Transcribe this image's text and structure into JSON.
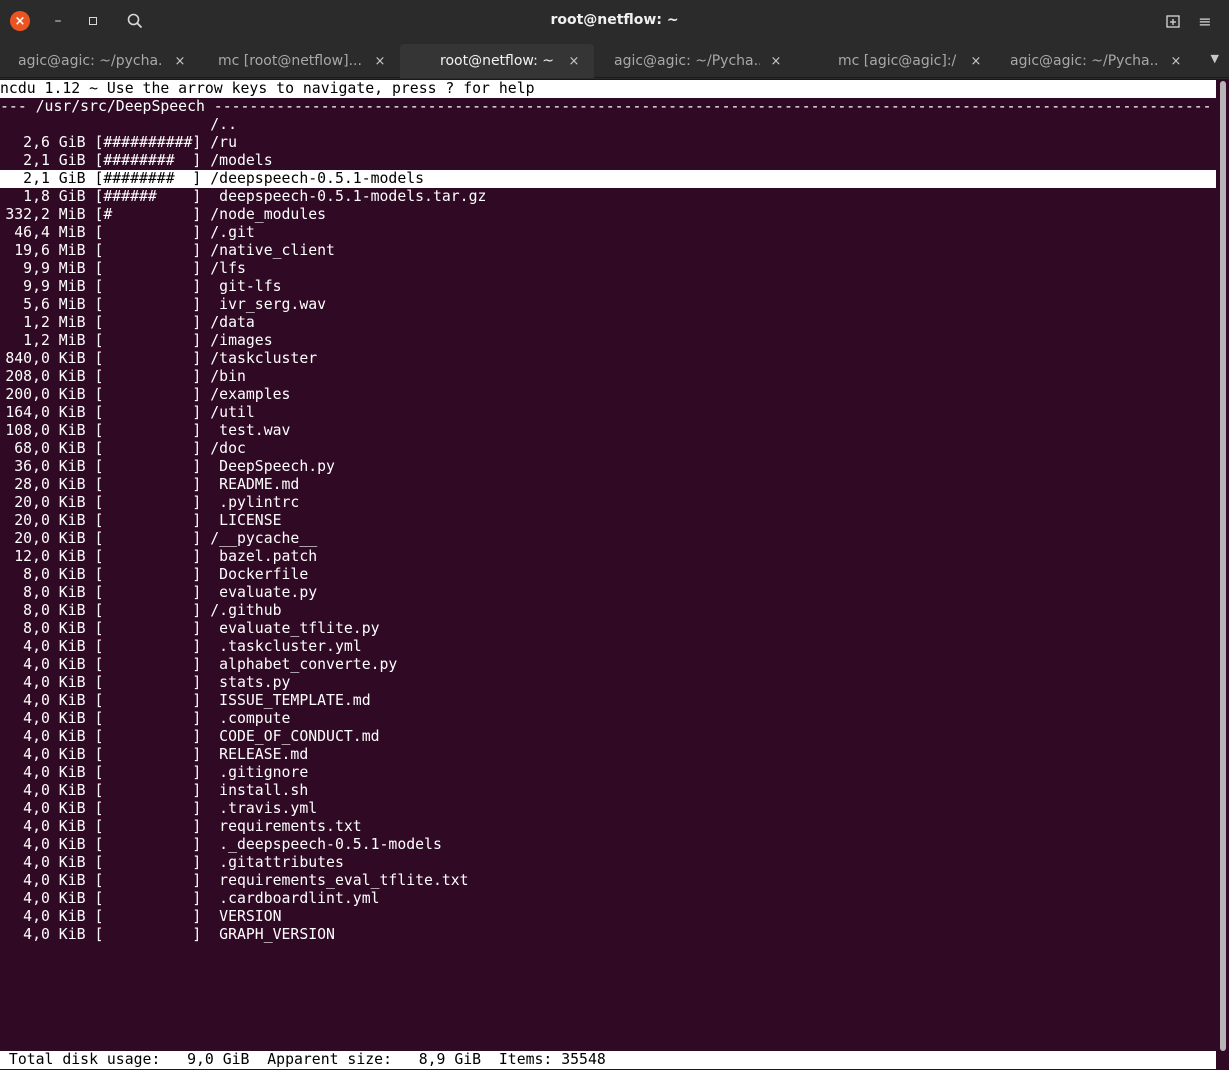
{
  "window": {
    "title": "root@netflow: ~",
    "close_glyph": "×",
    "minimize_glyph": "–",
    "menu_glyph": "≡"
  },
  "tabs": [
    {
      "label": "agic@agic: ~/pycha..."
    },
    {
      "label": "mc [root@netflow]..."
    },
    {
      "label": "root@netflow: ~",
      "active": true
    },
    {
      "label": "agic@agic: ~/Pycha..."
    },
    {
      "label": "mc [agic@agic]:/"
    },
    {
      "label": "agic@agic: ~/Pycha..."
    }
  ],
  "tab_close_glyph": "×",
  "tab_overflow_glyph": "▼",
  "terminal": {
    "header": "ncdu 1.12 ~ Use the arrow keys to navigate, press ? for help",
    "path_line": "--- /usr/src/DeepSpeech ----------------------------------------------------------------------------------------------------------------",
    "selected_index": 3,
    "rows": [
      {
        "size": "",
        "bar": "",
        "name": "/.."
      },
      {
        "size": "2,6 GiB",
        "bar": "[##########]",
        "name": "/ru"
      },
      {
        "size": "2,1 GiB",
        "bar": "[########  ]",
        "name": "/models"
      },
      {
        "size": "2,1 GiB",
        "bar": "[########  ]",
        "name": "/deepspeech-0.5.1-models"
      },
      {
        "size": "1,8 GiB",
        "bar": "[######    ]",
        "name": " deepspeech-0.5.1-models.tar.gz"
      },
      {
        "size": "332,2 MiB",
        "bar": "[#         ]",
        "name": "/node_modules"
      },
      {
        "size": "46,4 MiB",
        "bar": "[          ]",
        "name": "/.git"
      },
      {
        "size": "19,6 MiB",
        "bar": "[          ]",
        "name": "/native_client"
      },
      {
        "size": "9,9 MiB",
        "bar": "[          ]",
        "name": "/lfs"
      },
      {
        "size": "9,9 MiB",
        "bar": "[          ]",
        "name": " git-lfs"
      },
      {
        "size": "5,6 MiB",
        "bar": "[          ]",
        "name": " ivr_serg.wav"
      },
      {
        "size": "1,2 MiB",
        "bar": "[          ]",
        "name": "/data"
      },
      {
        "size": "1,2 MiB",
        "bar": "[          ]",
        "name": "/images"
      },
      {
        "size": "840,0 KiB",
        "bar": "[          ]",
        "name": "/taskcluster"
      },
      {
        "size": "208,0 KiB",
        "bar": "[          ]",
        "name": "/bin"
      },
      {
        "size": "200,0 KiB",
        "bar": "[          ]",
        "name": "/examples"
      },
      {
        "size": "164,0 KiB",
        "bar": "[          ]",
        "name": "/util"
      },
      {
        "size": "108,0 KiB",
        "bar": "[          ]",
        "name": " test.wav"
      },
      {
        "size": "68,0 KiB",
        "bar": "[          ]",
        "name": "/doc"
      },
      {
        "size": "36,0 KiB",
        "bar": "[          ]",
        "name": " DeepSpeech.py"
      },
      {
        "size": "28,0 KiB",
        "bar": "[          ]",
        "name": " README.md"
      },
      {
        "size": "20,0 KiB",
        "bar": "[          ]",
        "name": " .pylintrc"
      },
      {
        "size": "20,0 KiB",
        "bar": "[          ]",
        "name": " LICENSE"
      },
      {
        "size": "20,0 KiB",
        "bar": "[          ]",
        "name": "/__pycache__"
      },
      {
        "size": "12,0 KiB",
        "bar": "[          ]",
        "name": " bazel.patch"
      },
      {
        "size": "8,0 KiB",
        "bar": "[          ]",
        "name": " Dockerfile"
      },
      {
        "size": "8,0 KiB",
        "bar": "[          ]",
        "name": " evaluate.py"
      },
      {
        "size": "8,0 KiB",
        "bar": "[          ]",
        "name": "/.github"
      },
      {
        "size": "8,0 KiB",
        "bar": "[          ]",
        "name": " evaluate_tflite.py"
      },
      {
        "size": "4,0 KiB",
        "bar": "[          ]",
        "name": " .taskcluster.yml"
      },
      {
        "size": "4,0 KiB",
        "bar": "[          ]",
        "name": " alphabet_converte.py"
      },
      {
        "size": "4,0 KiB",
        "bar": "[          ]",
        "name": " stats.py"
      },
      {
        "size": "4,0 KiB",
        "bar": "[          ]",
        "name": " ISSUE_TEMPLATE.md"
      },
      {
        "size": "4,0 KiB",
        "bar": "[          ]",
        "name": " .compute"
      },
      {
        "size": "4,0 KiB",
        "bar": "[          ]",
        "name": " CODE_OF_CONDUCT.md"
      },
      {
        "size": "4,0 KiB",
        "bar": "[          ]",
        "name": " RELEASE.md"
      },
      {
        "size": "4,0 KiB",
        "bar": "[          ]",
        "name": " .gitignore"
      },
      {
        "size": "4,0 KiB",
        "bar": "[          ]",
        "name": " install.sh"
      },
      {
        "size": "4,0 KiB",
        "bar": "[          ]",
        "name": " .travis.yml"
      },
      {
        "size": "4,0 KiB",
        "bar": "[          ]",
        "name": " requirements.txt"
      },
      {
        "size": "4,0 KiB",
        "bar": "[          ]",
        "name": " ._deepspeech-0.5.1-models"
      },
      {
        "size": "4,0 KiB",
        "bar": "[          ]",
        "name": " .gitattributes"
      },
      {
        "size": "4,0 KiB",
        "bar": "[          ]",
        "name": " requirements_eval_tflite.txt"
      },
      {
        "size": "4,0 KiB",
        "bar": "[          ]",
        "name": " .cardboardlint.yml"
      },
      {
        "size": "4,0 KiB",
        "bar": "[          ]",
        "name": " VERSION"
      },
      {
        "size": "4,0 KiB",
        "bar": "[          ]",
        "name": " GRAPH_VERSION"
      }
    ],
    "footer": " Total disk usage:   9,0 GiB  Apparent size:   8,9 GiB  Items: 35548"
  },
  "colors": {
    "terminal_bg": "#300a24",
    "close_button": "#e95420"
  }
}
